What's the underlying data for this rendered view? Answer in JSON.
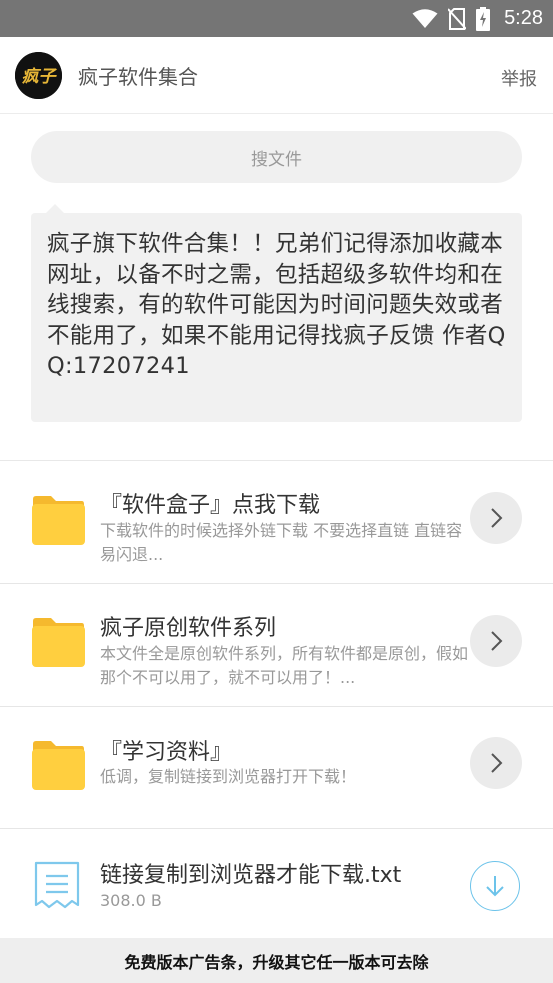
{
  "status_bar": {
    "time": "5:28",
    "icons": [
      "wifi-icon",
      "no-sim-icon",
      "battery-charging-icon"
    ]
  },
  "header": {
    "title": "疯子软件集合",
    "report_label": "举报",
    "avatar_text": "疯子"
  },
  "search": {
    "placeholder": "搜文件"
  },
  "notice": {
    "text": "疯子旗下软件合集！！兄弟们记得添加收藏本网址，以备不时之需，包括超级多软件均和在线搜索，有的软件可能因为时间问题失效或者不能用了，如果不能用记得找疯子反馈 作者QQ:17207241"
  },
  "items": [
    {
      "type": "folder",
      "title": "『软件盒子』点我下载",
      "subtitle": "下载软件的时候选择外链下载 不要选择直链 直链容易闪退..."
    },
    {
      "type": "folder",
      "title": "疯子原创软件系列",
      "subtitle": "本文件全是原创软件系列，所有软件都是原创，假如那个不可以用了，就不可以用了！..."
    },
    {
      "type": "folder",
      "title": "『学习资料』",
      "subtitle": "低调，复制链接到浏览器打开下载！"
    },
    {
      "type": "file",
      "title": "链接复制到浏览器才能下载.txt",
      "subtitle": "308.0 B"
    }
  ],
  "ad_banner": {
    "text": "免费版本广告条，升级其它任一版本可去除"
  },
  "colors": {
    "status_bar": "#757575",
    "folder": "#FFCF3F",
    "folder_tab": "#F5B92E",
    "file_icon": "#7EC8EC",
    "download_accent": "#6CC3EA"
  }
}
